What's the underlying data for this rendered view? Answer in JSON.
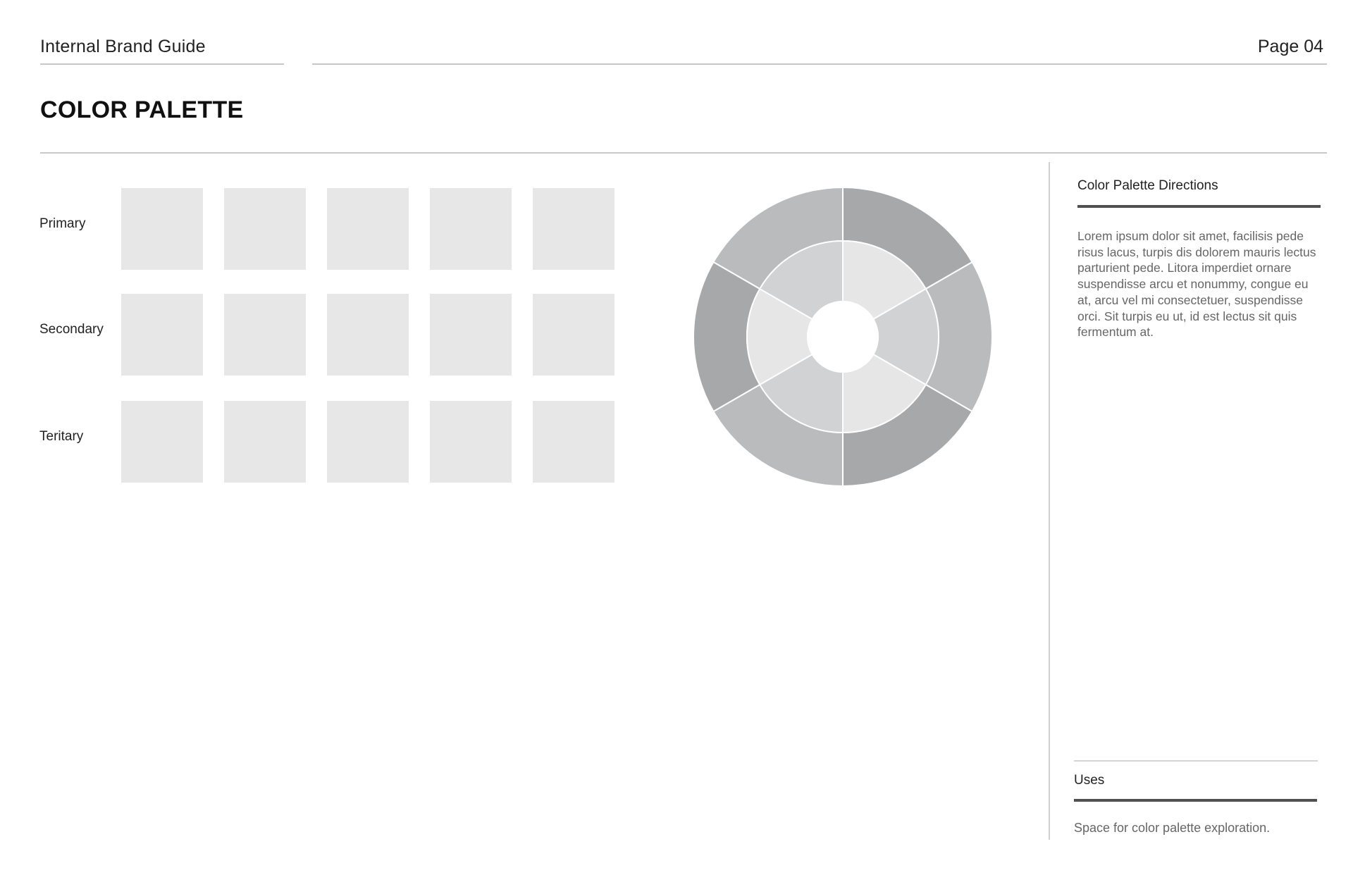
{
  "header": {
    "title": "Internal Brand Guide",
    "page": "Page 04"
  },
  "page_title": "COLOR PALETTE",
  "palette": {
    "rows": [
      {
        "label": "Primary",
        "swatches": [
          "#e7e7e7",
          "#e7e7e7",
          "#e7e7e7",
          "#e7e7e7",
          "#e7e7e7"
        ]
      },
      {
        "label": "Secondary",
        "swatches": [
          "#e7e7e7",
          "#e7e7e7",
          "#e7e7e7",
          "#e7e7e7",
          "#e7e7e7"
        ]
      },
      {
        "label": "Teritary",
        "swatches": [
          "#e7e7e7",
          "#e7e7e7",
          "#e7e7e7",
          "#e7e7e7",
          "#e7e7e7"
        ]
      }
    ]
  },
  "color_wheel": {
    "outer_ring": [
      "#b9bbbc",
      "#a6a8a9",
      "#b9bbbc",
      "#a6a8a9",
      "#b9bbbc",
      "#a6a8a9"
    ],
    "inner_ring": [
      "#e6e6e6",
      "#d0d2d3",
      "#e6e6e6",
      "#d0d2d3",
      "#e6e6e6",
      "#d0d2d3"
    ],
    "center": "#ffffff"
  },
  "sidebar": {
    "directions_title": "Color Palette Directions",
    "directions_body": "Lorem ipsum dolor sit amet, facilisis pede risus lacus, turpis dis dolorem mauris lectus parturient pede. Litora imperdiet ornare suspendisse arcu et nonummy, congue eu at, arcu vel mi consectetuer, suspendisse orci. Sit turpis eu ut, id est lectus sit quis fermentum at.",
    "uses_title": "Uses",
    "uses_body": "Space for color palette exploration."
  }
}
